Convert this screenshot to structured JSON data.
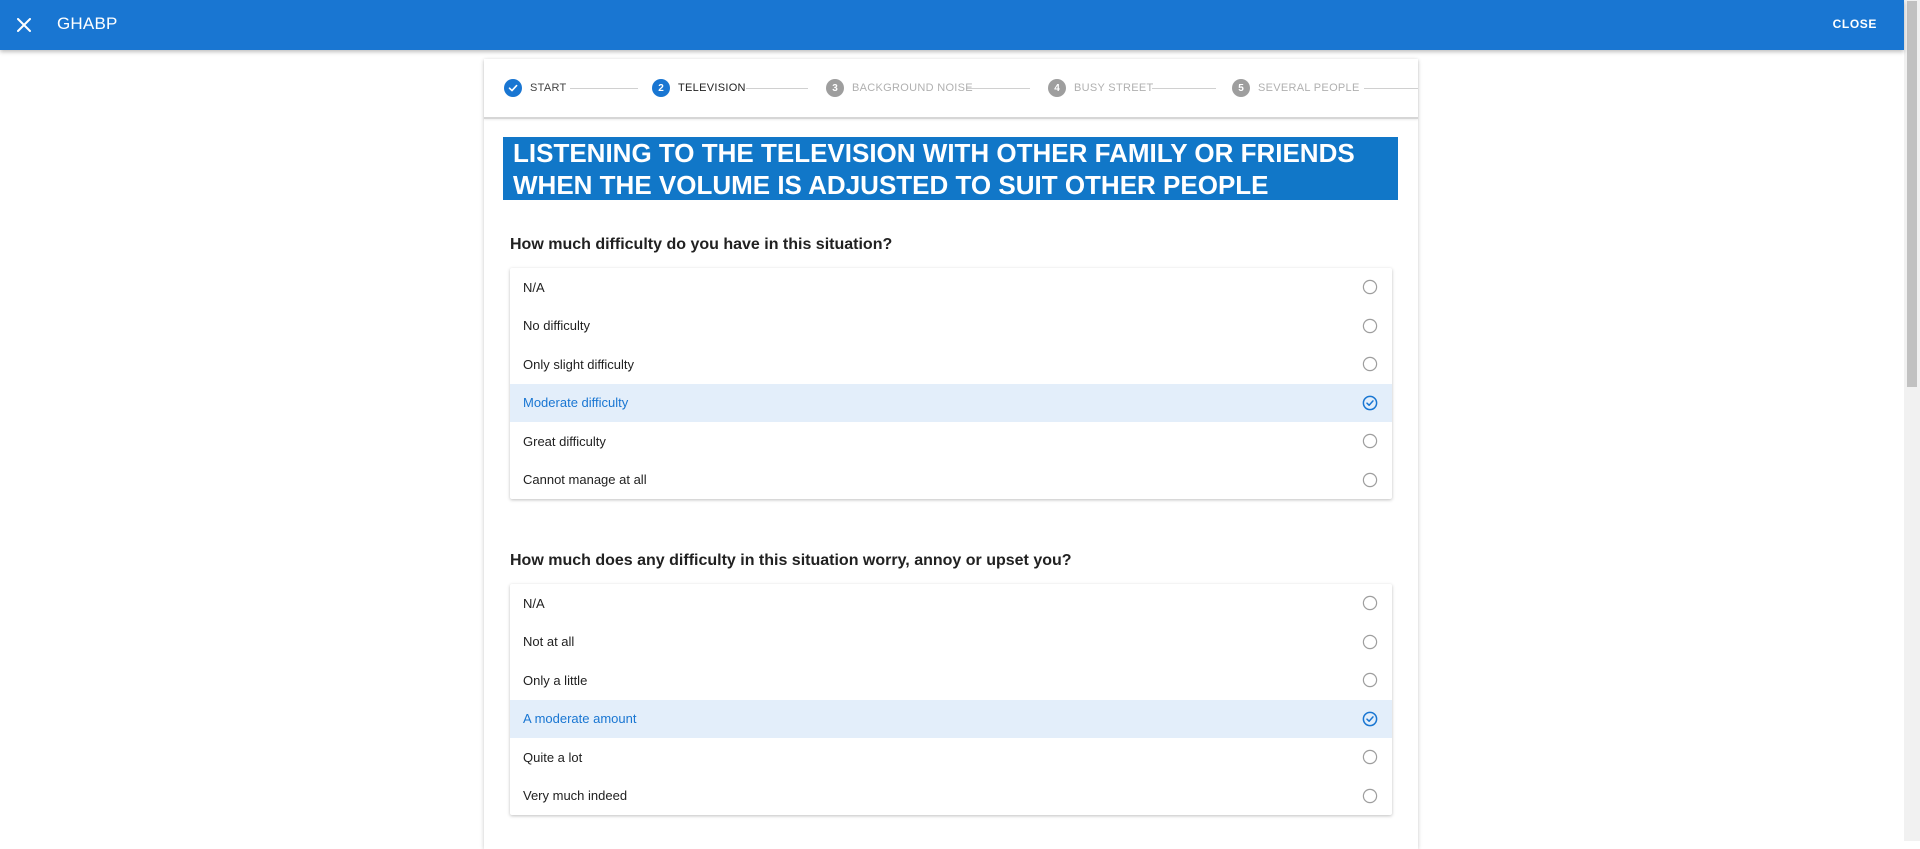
{
  "app": {
    "title": "GHABP",
    "close_label": "CLOSE",
    "accent_color": "#1976d2"
  },
  "stepper": {
    "steps": [
      {
        "number": "",
        "label": "START",
        "state": "done"
      },
      {
        "number": "2",
        "label": "TELEVISION",
        "state": "active"
      },
      {
        "number": "3",
        "label": "BACKGROUND NOISE",
        "state": "todo"
      },
      {
        "number": "4",
        "label": "BUSY STREET",
        "state": "todo"
      },
      {
        "number": "5",
        "label": "SEVERAL PEOPLE",
        "state": "todo"
      }
    ]
  },
  "situation": {
    "line1": "LISTENING TO THE TELEVISION WITH OTHER FAMILY OR FRIENDS",
    "line2": "WHEN THE VOLUME IS ADJUSTED TO SUIT OTHER PEOPLE"
  },
  "questions": [
    {
      "text": "How much difficulty do you have in this situation?",
      "options": [
        "N/A",
        "No difficulty",
        "Only slight difficulty",
        "Moderate difficulty",
        "Great difficulty",
        "Cannot manage at all"
      ],
      "selected": "Moderate difficulty"
    },
    {
      "text": "How much does any difficulty in this situation worry, annoy or upset you?",
      "options": [
        "N/A",
        "Not at all",
        "Only a little",
        "A moderate amount",
        "Quite a lot",
        "Very much indeed"
      ],
      "selected": "A moderate amount"
    }
  ]
}
